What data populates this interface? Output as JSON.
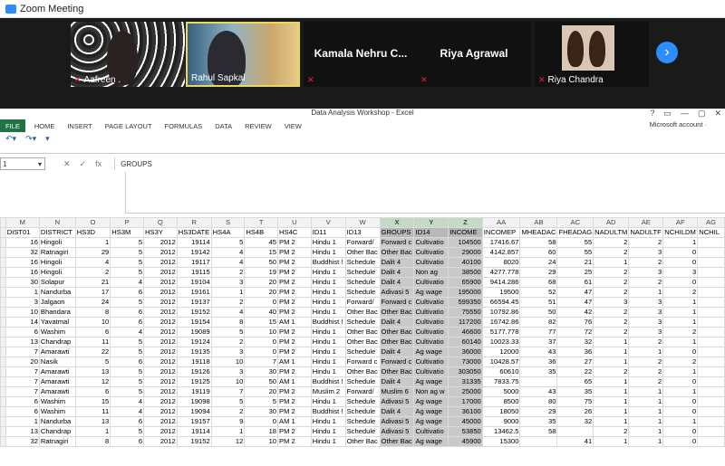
{
  "zoom": {
    "window_title": "Zoom Meeting",
    "participants": [
      {
        "name": "Aafreen .",
        "muted": true
      },
      {
        "name": "Rahul Sapkal",
        "muted": false
      },
      {
        "name": "Kamala  Nehru  C...",
        "muted": true
      },
      {
        "name": "Riya Agrawal",
        "muted": true
      },
      {
        "name": "Riya Chandra",
        "muted": true
      }
    ],
    "next_icon": "chevron-right-icon"
  },
  "excel": {
    "window_title": "Data Analysis Workshop - Excel",
    "window_buttons": [
      "?",
      "▭",
      "—",
      "▢",
      "✕"
    ],
    "ribbon_tabs": [
      "FILE",
      "HOME",
      "INSERT",
      "PAGE LAYOUT",
      "FORMULAS",
      "DATA",
      "REVIEW",
      "VIEW"
    ],
    "account": "Microsoft account ·",
    "name_box": "1",
    "fx_symbol": "fx",
    "formula_content": "GROUPS",
    "column_letters": [
      "M",
      "N",
      "O",
      "P",
      "Q",
      "R",
      "S",
      "T",
      "U",
      "V",
      "W",
      "X",
      "Y",
      "Z",
      "AA",
      "AB",
      "AC",
      "AD",
      "AE",
      "AF",
      "AG"
    ],
    "selected_columns": [
      "X",
      "Y",
      "Z"
    ],
    "rows": [
      [
        "DIST01",
        "DISTRICT",
        "HS3D",
        "HS3M",
        "HS3Y",
        "HS3DATE",
        "HS4A",
        "HS4B",
        "HS4C",
        "ID11",
        "ID13",
        "GROUPS",
        "ID14",
        "INCOME",
        "INCOMEP",
        "MHEADAC",
        "FHEADAG",
        "NADULTM",
        "NADULTF",
        "NCHILDM",
        "NCHIL"
      ],
      [
        "16",
        "Hingoli",
        "1",
        "5",
        "2012",
        "19114",
        "5",
        "45",
        "PM 2",
        "Hindu 1",
        "Forward/",
        "Forward c",
        "Cultivatio",
        "104500",
        "17416.67",
        "58",
        "55",
        "2",
        "2",
        "1",
        ""
      ],
      [
        "32",
        "Ratnagiri",
        "29",
        "5",
        "2012",
        "19142",
        "4",
        "15",
        "PM 2",
        "Hindu 1",
        "Other Bac",
        "Other Bac",
        "Cultivatio",
        "29000",
        "4142.857",
        "60",
        "55",
        "2",
        "3",
        "0",
        ""
      ],
      [
        "16",
        "Hingoli",
        "4",
        "5",
        "2012",
        "19117",
        "4",
        "50",
        "PM 2",
        "Buddhist !",
        "Schedule",
        "Dalit 4",
        "Cultivatio",
        "40100",
        "8020",
        "24",
        "21",
        "1",
        "2",
        "0",
        ""
      ],
      [
        "16",
        "Hingoli",
        "2",
        "5",
        "2012",
        "19115",
        "2",
        "19",
        "PM 2",
        "Hindu 1",
        "Schedule",
        "Dalit 4",
        "Non ag",
        "38500",
        "4277.778",
        "29",
        "25",
        "2",
        "3",
        "3",
        ""
      ],
      [
        "30",
        "Solapur",
        "21",
        "4",
        "2012",
        "19104",
        "3",
        "20",
        "PM 2",
        "Hindu 1",
        "Schedule",
        "Dalit 4",
        "Cultivatio",
        "65900",
        "9414.286",
        "68",
        "61",
        "2",
        "2",
        "0",
        ""
      ],
      [
        "1",
        "Nandurba",
        "17",
        "6",
        "2012",
        "19161",
        "1",
        "20",
        "PM 2",
        "Hindu 1",
        "Schedule",
        "Adivasi 5",
        "Ag wage",
        "195000",
        "19500",
        "52",
        "47",
        "2",
        "1",
        "2",
        ""
      ],
      [
        "3",
        "Jalgaon",
        "24",
        "5",
        "2012",
        "19137",
        "2",
        "0",
        "PM 2",
        "Hindu 1",
        "Forward/",
        "Forward c",
        "Cultivatio",
        "599350",
        "66594.45",
        "51",
        "47",
        "3",
        "3",
        "1",
        ""
      ],
      [
        "10",
        "Bhandara",
        "8",
        "6",
        "2012",
        "19152",
        "4",
        "40",
        "PM 2",
        "Hindu 1",
        "Other Bac",
        "Other Bac",
        "Cultivatio",
        "75550",
        "10792.86",
        "50",
        "42",
        "2",
        "3",
        "1",
        ""
      ],
      [
        "14",
        "Yavatmal",
        "10",
        "6",
        "2012",
        "19154",
        "8",
        "15",
        "AM 1",
        "Buddhist !",
        "Schedule",
        "Dalit 4",
        "Cultivatio",
        "117200",
        "16742.86",
        "82",
        "76",
        "2",
        "3",
        "1",
        ""
      ],
      [
        "6",
        "Washim",
        "6",
        "4",
        "2012",
        "19089",
        "5",
        "10",
        "PM 2",
        "Hindu 1",
        "Other Bac",
        "Other Bac",
        "Cultivatio",
        "46600",
        "5177.778",
        "77",
        "72",
        "2",
        "3",
        "2",
        ""
      ],
      [
        "13",
        "Chandrap",
        "11",
        "5",
        "2012",
        "19124",
        "2",
        "0",
        "PM 2",
        "Hindu 1",
        "Other Bac",
        "Other Bac",
        "Cultivatio",
        "60140",
        "10023.33",
        "37",
        "32",
        "1",
        "2",
        "1",
        ""
      ],
      [
        "7",
        "Amarawti",
        "22",
        "5",
        "2012",
        "19135",
        "3",
        "0",
        "PM 2",
        "Hindu 1",
        "Schedule",
        "Dalit 4",
        "Ag wage",
        "36000",
        "12000",
        "43",
        "36",
        "1",
        "1",
        "0",
        ""
      ],
      [
        "20",
        "Nasik",
        "5",
        "6",
        "2012",
        "19118",
        "10",
        "7",
        "AM 1",
        "Hindu 1",
        "Forward c",
        "Forward c",
        "Cultivatio",
        "73000",
        "10428.57",
        "36",
        "27",
        "1",
        "2",
        "2",
        ""
      ],
      [
        "7",
        "Amarawti",
        "13",
        "5",
        "2012",
        "19126",
        "3",
        "30",
        "PM 2",
        "Hindu 1",
        "Other Bac",
        "Other Bac",
        "Cultivatio",
        "303050",
        "60610",
        "35",
        "22",
        "2",
        "2",
        "1",
        ""
      ],
      [
        "7",
        "Amarawti",
        "12",
        "5",
        "2012",
        "19125",
        "10",
        "50",
        "AM 1",
        "Buddhist !",
        "Schedule",
        "Dalit 4",
        "Ag wage",
        "31335",
        "7833.75",
        "",
        "65",
        "1",
        "2",
        "0",
        ""
      ],
      [
        "7",
        "Amarawti",
        "6",
        "5",
        "2012",
        "19119",
        "7",
        "20",
        "PM 2",
        "Muslim 2",
        "Forward/",
        "Muslim 6",
        "Non ag w",
        "25000",
        "5000",
        "43",
        "35",
        "1",
        "1",
        "1",
        ""
      ],
      [
        "6",
        "Washim",
        "15",
        "4",
        "2012",
        "19098",
        "5",
        "5",
        "PM 2",
        "Hindu 1",
        "Schedule",
        "Adivasi 5",
        "Ag wage",
        "17000",
        "8500",
        "80",
        "75",
        "1",
        "1",
        "0",
        ""
      ],
      [
        "6",
        "Washim",
        "11",
        "4",
        "2012",
        "19094",
        "2",
        "30",
        "PM 2",
        "Buddhist !",
        "Schedule",
        "Dalit 4",
        "Ag wage",
        "36100",
        "18050",
        "29",
        "26",
        "1",
        "1",
        "0",
        ""
      ],
      [
        "1",
        "Nandurba",
        "13",
        "6",
        "2012",
        "19157",
        "9",
        "0",
        "AM 1",
        "Hindu 1",
        "Schedule",
        "Adivasi 5",
        "Ag wage",
        "45000",
        "9000",
        "35",
        "32",
        "1",
        "1",
        "1",
        ""
      ],
      [
        "13",
        "Chandrap",
        "1",
        "5",
        "2012",
        "19114",
        "1",
        "18",
        "PM 2",
        "Hindu 1",
        "Schedule",
        "Adivasi 5",
        "Cultivatio",
        "53850",
        "13462.5",
        "58",
        "",
        "2",
        "1",
        "0",
        ""
      ],
      [
        "32",
        "Ratnagiri",
        "8",
        "6",
        "2012",
        "19152",
        "12",
        "10",
        "PM 2",
        "Hindu 1",
        "Other Bac",
        "Other Bac",
        "Ag wage",
        "45900",
        "15300",
        "",
        "41",
        "1",
        "1",
        "0",
        ""
      ]
    ]
  }
}
